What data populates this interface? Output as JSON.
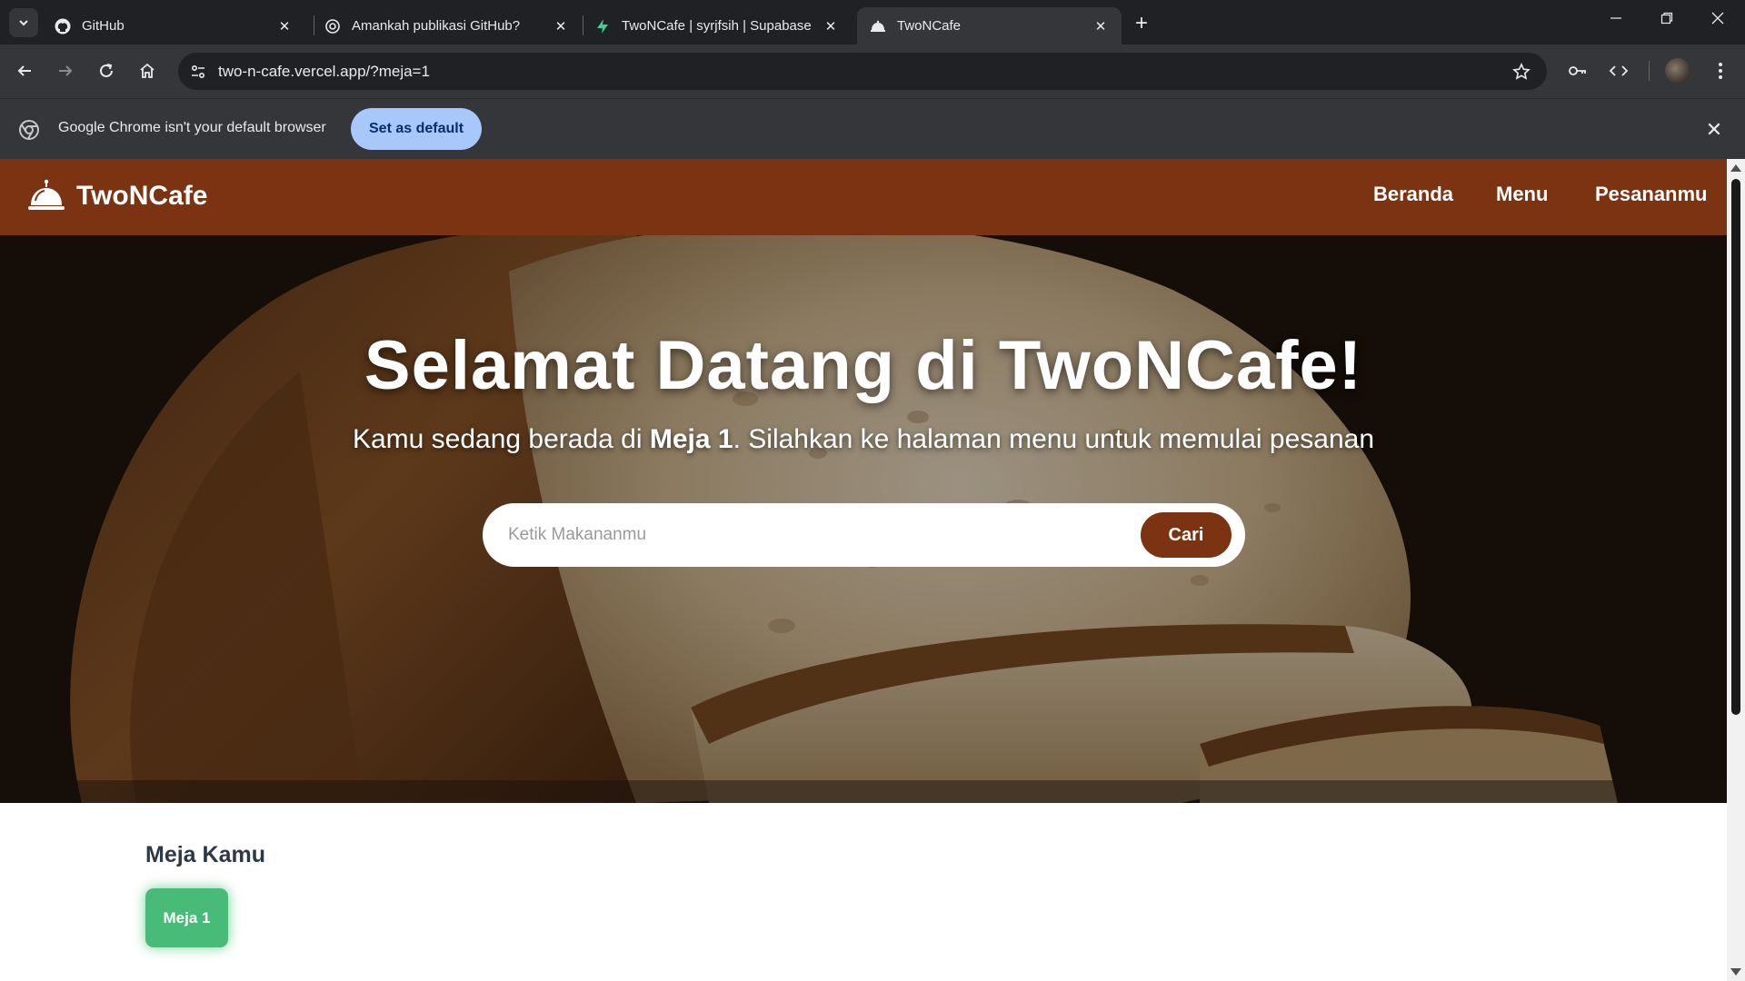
{
  "browser": {
    "tabs": [
      {
        "title": "GitHub",
        "icon": "github-icon"
      },
      {
        "title": "Amankah publikasi GitHub?",
        "icon": "chatgpt-icon"
      },
      {
        "title": "TwoNCafe | syrjfsih | Supabase",
        "icon": "supabase-icon"
      },
      {
        "title": "TwoNCafe",
        "icon": "cafe-cloche-icon",
        "active": true
      }
    ],
    "url": "two-n-cafe.vercel.app/?meja=1",
    "infobar": {
      "message": "Google Chrome isn't your default browser",
      "button": "Set as default"
    }
  },
  "site": {
    "brand": "TwoNCafe",
    "nav": [
      "Beranda",
      "Menu",
      "Pesananmu"
    ],
    "hero": {
      "title": "Selamat Datang di TwoNCafe!",
      "subtitle_pre": "Kamu sedang berada di ",
      "subtitle_table": "Meja 1",
      "subtitle_post": ". Silahkan ke halaman menu untuk memulai pesanan",
      "search_placeholder": "Ketik Makananmu",
      "search_button": "Cari"
    },
    "table_section": {
      "title": "Meja Kamu",
      "table_label": "Meja 1"
    }
  },
  "colors": {
    "brand_brown": "#7b3312",
    "table_green": "#48bb78",
    "chrome_dark": "#202124",
    "chrome_toolbar": "#35363a"
  }
}
